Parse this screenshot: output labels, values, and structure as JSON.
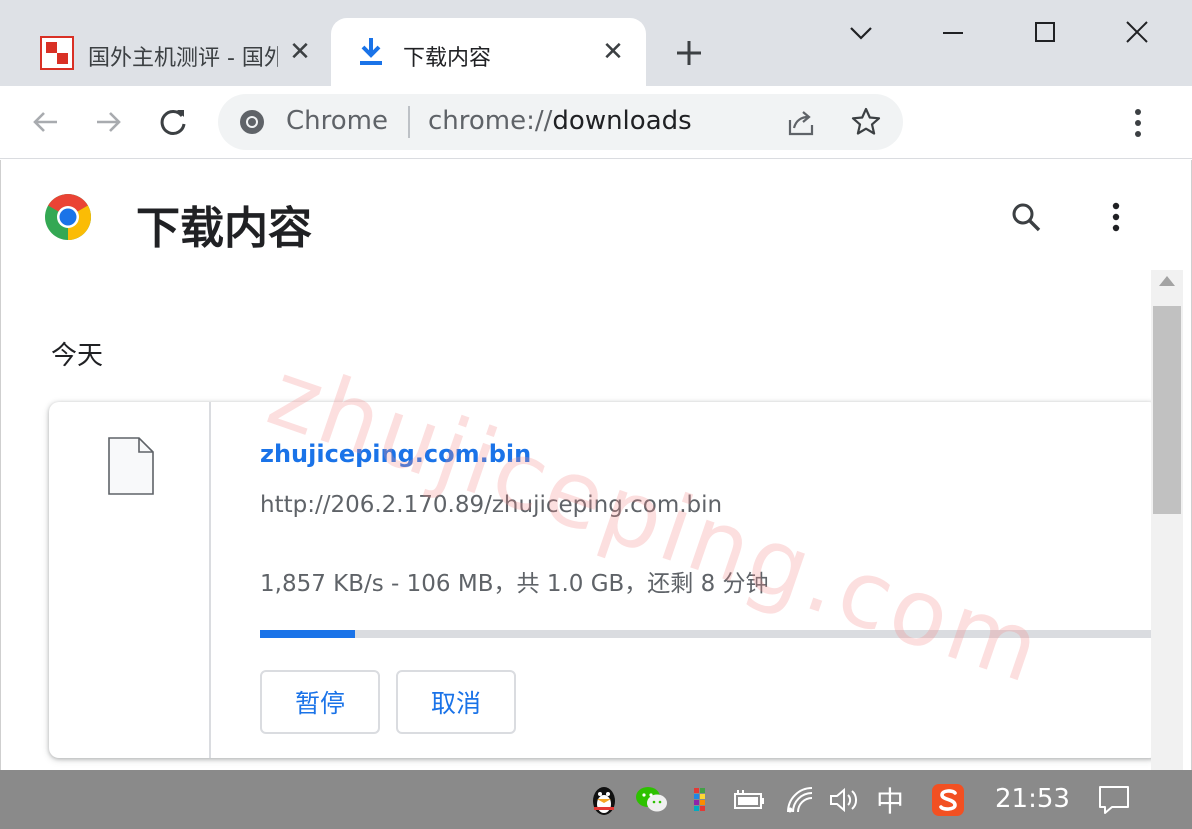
{
  "tabs": [
    {
      "title": "国外主机测评 - 国外VPS",
      "active": false
    },
    {
      "title": "下载内容",
      "active": true
    }
  ],
  "omnibox": {
    "chip": "Chrome",
    "url_scheme": "chrome://",
    "url_host": "downloads"
  },
  "page": {
    "title": "下载内容",
    "date_header": "今天"
  },
  "watermark": "zhujiceping.com",
  "download": {
    "file_name": "zhujiceping.com.bin",
    "url": "http://206.2.170.89/zhujiceping.com.bin",
    "status": "1,857 KB/s - 106 MB，共 1.0 GB，还剩 8 分钟",
    "progress_fraction": 0.106,
    "pause_label": "暂停",
    "cancel_label": "取消"
  },
  "taskbar": {
    "ime": "中",
    "clock": "21:53"
  },
  "colors": {
    "accent": "#1a73e8",
    "tabstrip": "#dee1e6",
    "taskbar": "#8a8a8a"
  }
}
